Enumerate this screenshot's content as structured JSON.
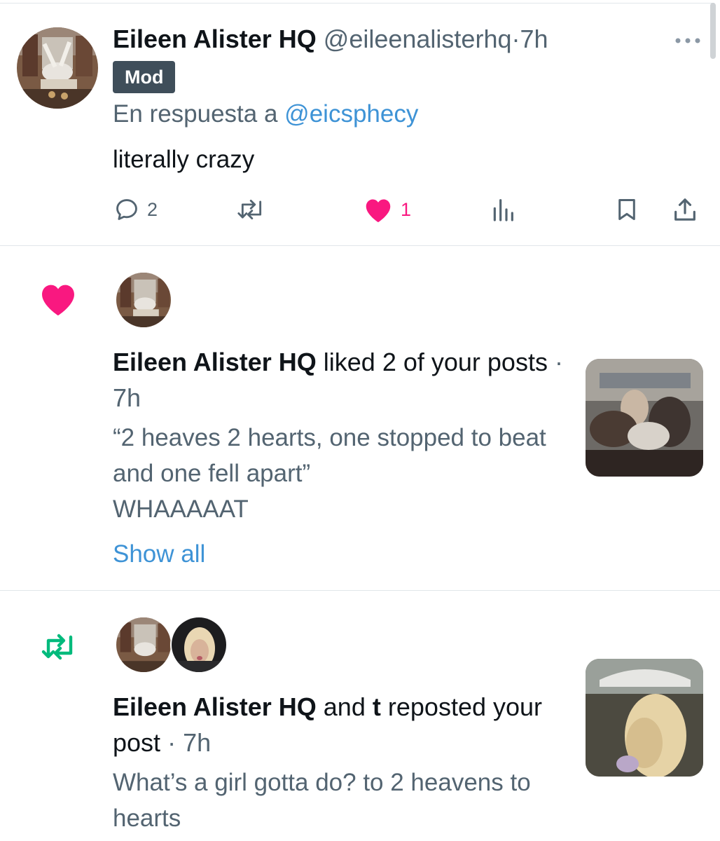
{
  "tweet": {
    "author_name": "Eileen Alister HQ",
    "handle": "@eileenalisterhq",
    "separator": "·",
    "time": "7h",
    "badge": "Mod",
    "reply_prefix": "En respuesta a",
    "reply_mention": "@eicsphecy",
    "text": "literally crazy",
    "actions": {
      "reply_count": "2",
      "like_count": "1"
    },
    "icons": [
      "more-icon",
      "reply-icon",
      "repost-icon",
      "like-icon",
      "views-icon",
      "bookmark-icon",
      "share-icon"
    ]
  },
  "notifications": [
    {
      "type": "like",
      "icon": "heart-icon",
      "actor": "Eileen Alister HQ",
      "action": "liked 2 of your posts",
      "separator": "·",
      "time": "7h",
      "preview_line1": "“2 heaves 2 hearts, one stopped to beat and one fell apart”",
      "preview_line2": "WHAAAAAT",
      "show_all": "Show all"
    },
    {
      "type": "repost",
      "icon": "repost-icon",
      "actor": "Eileen Alister HQ",
      "conjunction": "and",
      "actor2": "t",
      "action": "reposted your post",
      "separator": "·",
      "time": "7h",
      "preview": "What’s a girl gotta do? to 2 heavens to hearts"
    }
  ],
  "colors": {
    "like_pink": "#f91880",
    "repost_green": "#00ba7c",
    "link_blue": "#3e93d6",
    "secondary_text": "#536471",
    "badge_bg": "#3f4e5a"
  }
}
